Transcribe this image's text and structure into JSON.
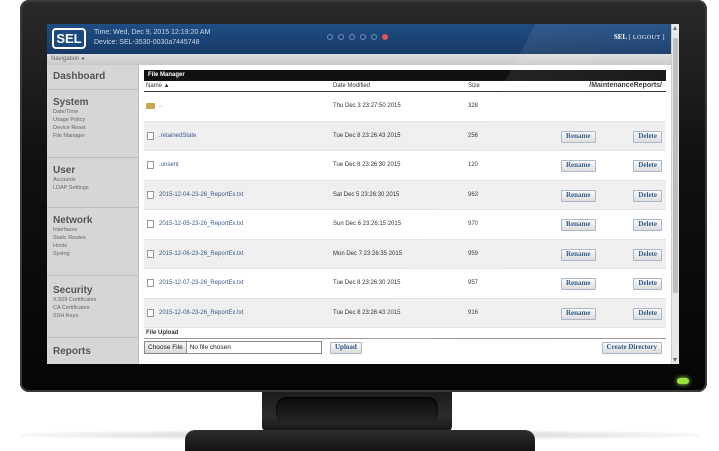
{
  "header": {
    "logo": "SEL",
    "time": "Time: Wed, Dec 9, 2015 12:19:20 AM",
    "device": "Device: SEL-3530-0030a7445748",
    "user": "SEL",
    "logout": "[ LOGOUT ]"
  },
  "nav_bar": {
    "label": "Navigation"
  },
  "sidebar": {
    "dashboard": "Dashboard",
    "sections": [
      {
        "title": "System",
        "items": [
          "Date/Time",
          "Usage Policy",
          "Device Reset",
          "File Manager"
        ]
      },
      {
        "title": "User",
        "items": [
          "Accounts",
          "LDAP Settings"
        ]
      },
      {
        "title": "Network",
        "items": [
          "Interfaces",
          "Static Routes",
          "Hosts",
          "Syslog"
        ]
      },
      {
        "title": "Security",
        "items": [
          "X.509 Certificates",
          "CA Certificates",
          "SSH Keys"
        ]
      },
      {
        "title": "Reports",
        "items": []
      }
    ]
  },
  "file_manager": {
    "title": "File Manager",
    "columns": {
      "name": "Name ▲",
      "date": "Date Modified",
      "size": "Size"
    },
    "path": "/MaintenanceReports/",
    "rename_label": "Rename",
    "delete_label": "Delete",
    "rows": [
      {
        "name": "..",
        "date": "Thu Dec 3 23:27:50 2015",
        "size": "328",
        "type": "folder"
      },
      {
        "name": ".retainedState",
        "date": "Tue Dec 8 23:26:43 2015",
        "size": "256",
        "type": "file"
      },
      {
        "name": ".unsent",
        "date": "Tue Dec 8 23:26:30 2015",
        "size": "120",
        "type": "file"
      },
      {
        "name": "2015-12-04-23-26_ReportEx.txt",
        "date": "Sat Dec 5 23:26:30 2015",
        "size": "963",
        "type": "file"
      },
      {
        "name": "2015-12-05-23-26_ReportEx.txt",
        "date": "Sun Dec 6 23:26:15 2015",
        "size": "970",
        "type": "file"
      },
      {
        "name": "2015-12-06-23-26_ReportEx.txt",
        "date": "Mon Dec 7 23:26:35 2015",
        "size": "959",
        "type": "file"
      },
      {
        "name": "2015-12-07-23-26_ReportEx.txt",
        "date": "Tue Dec 8 23:26:30 2015",
        "size": "957",
        "type": "file"
      },
      {
        "name": "2015-12-08-23-26_ReportEx.txt",
        "date": "Tue Dec 8 23:26:43 2015",
        "size": "916",
        "type": "file"
      }
    ]
  },
  "file_upload": {
    "title": "File Upload",
    "choose_label": "Choose File",
    "no_file": "No file chosen",
    "upload_label": "Upload",
    "create_dir_label": "Create Directory"
  },
  "colors": {
    "header": "#1f4e85",
    "accent_active_dot": "#e65555",
    "led": "#9be03c"
  }
}
